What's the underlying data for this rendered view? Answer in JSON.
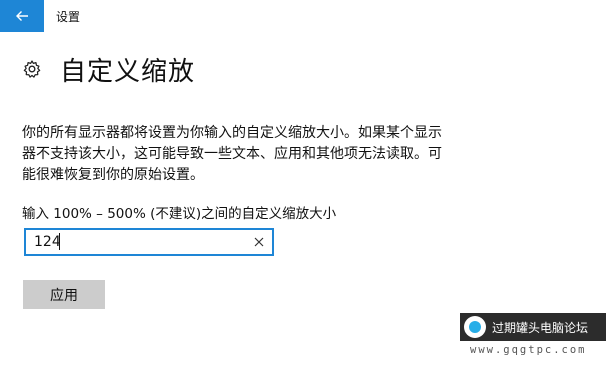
{
  "window": {
    "title": "设置"
  },
  "header": {
    "title": "自定义缩放"
  },
  "main": {
    "description": "你的所有显示器都将设置为你输入的自定义缩放大小。如果某个显示器不支持该大小，这可能导致一些文本、应用和其他项无法读取。可能很难恢复到你的原始设置。",
    "input_label": "输入 100% – 500% (不建议)之间的自定义缩放大小",
    "input_value": "124",
    "apply_label": "应用"
  },
  "watermark": {
    "text": "过期罐头电脑论坛",
    "url": "www.gqgtpc.com"
  },
  "colors": {
    "accent": "#1e86d6",
    "button_bg": "#cccccc"
  },
  "icons": {
    "back": "back-arrow-icon",
    "settings": "gear-icon",
    "clear": "close-icon"
  }
}
